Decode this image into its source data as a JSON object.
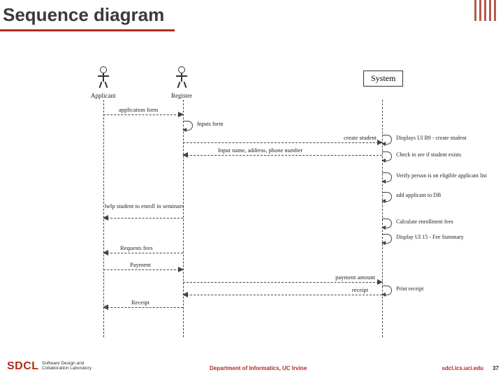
{
  "title": "Sequence diagram",
  "actors": {
    "applicant": "Applicant",
    "register": "Register",
    "system": "System"
  },
  "messages": {
    "m1": "application form",
    "m2": "Inputs form",
    "m3": "create student",
    "m4": "Displays UI B9 - create student",
    "m5": "Input name, address, phone number",
    "m6": "Check to see if student exists",
    "m7": "Verify person is on eligible applicant list",
    "m8": "add applicant to DB",
    "m9": "help student to enroll in seminars",
    "m10": "Calculate enrollment fees",
    "m11": "Display UI 15 - Fee Summary",
    "m12": "Requests fees",
    "m13": "Payment",
    "m14": "payment amount",
    "m15": "receipt",
    "m16": "Print receipt",
    "m17": "Receipt"
  },
  "footer": {
    "logo": "SDCL",
    "logo_sub1": "Software Design and",
    "logo_sub2": "Collaboration Laboratory",
    "dept": "Department of Informatics, UC Irvine",
    "url": "sdcl.ics.uci.edu",
    "page": "37"
  }
}
